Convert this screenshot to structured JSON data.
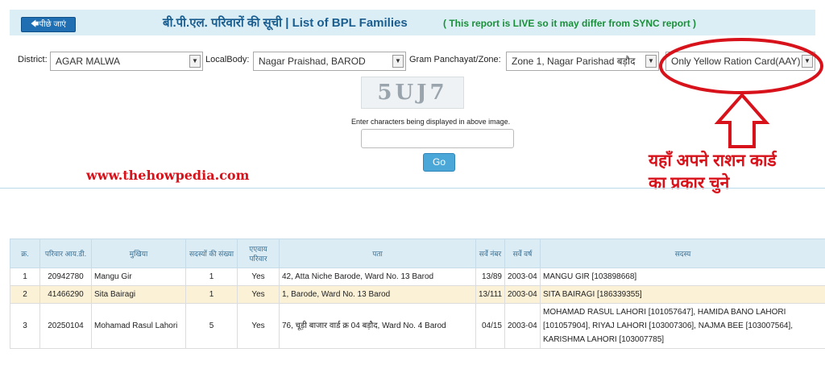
{
  "header": {
    "back_label": "🡄पीछे जाएं",
    "title": "बी.पी.एल. परिवारों की सूची | List of BPL Families",
    "live_note": "( This report is LIVE so it may differ from SYNC report )"
  },
  "filters": {
    "district_label": "District:",
    "district_value": "AGAR MALWA",
    "localbody_label": "LocalBody:",
    "localbody_value": "Nagar Praishad, BAROD",
    "gp_label": "Gram Panchayat/Zone:",
    "gp_value": "Zone 1, Nagar Parishad बड़ौद",
    "card_value": "Only Yellow Ration Card(AAY)"
  },
  "captcha": {
    "text": "5UJ7",
    "label": "Enter characters being displayed in above image.",
    "input_value": "",
    "go_label": "Go"
  },
  "watermark": "www.thehowpedia.com",
  "annotation": {
    "line1": "यहाँ अपने राशन कार्ड",
    "line2": "का प्रकार चुने",
    "color": "#d8121b"
  },
  "table": {
    "headers": [
      "क्र.",
      "परिवार आय.डी.",
      "मुखिया",
      "सदस्यों की संख्या",
      "एएवाय परिवार",
      "पता",
      "सर्वे नंबर",
      "सर्वे वर्ष",
      "सदस्य"
    ],
    "rows": [
      {
        "sno": "1",
        "family_id": "20942780",
        "head": "Mangu Gir",
        "members_count": "1",
        "aay": "Yes",
        "address": "42, Atta Niche Barode, Ward No. 13 Barod",
        "survey_no": "13/89",
        "survey_year": "2003-04",
        "members": "MANGU GIR [103898668]"
      },
      {
        "sno": "2",
        "family_id": "41466290",
        "head": "Sita Bairagi",
        "members_count": "1",
        "aay": "Yes",
        "address": "1, Barode, Ward No. 13 Barod",
        "survey_no": "13/111",
        "survey_year": "2003-04",
        "members": "SITA BAIRAGI [186339355]"
      },
      {
        "sno": "3",
        "family_id": "20250104",
        "head": "Mohamad Rasul Lahori",
        "members_count": "5",
        "aay": "Yes",
        "address": "76, चूड़ी बाजार वार्ड क्र 04 बड़ौद, Ward No. 4 Barod",
        "survey_no": "04/15",
        "survey_year": "2003-04",
        "members": "MOHAMAD RASUL LAHORI [101057647], HAMIDA BANO LAHORI [101057904], RIYAJ LAHORI [103007306], NAJMA BEE [103007564], KARISHMA LAHORI [103007785]"
      }
    ]
  }
}
